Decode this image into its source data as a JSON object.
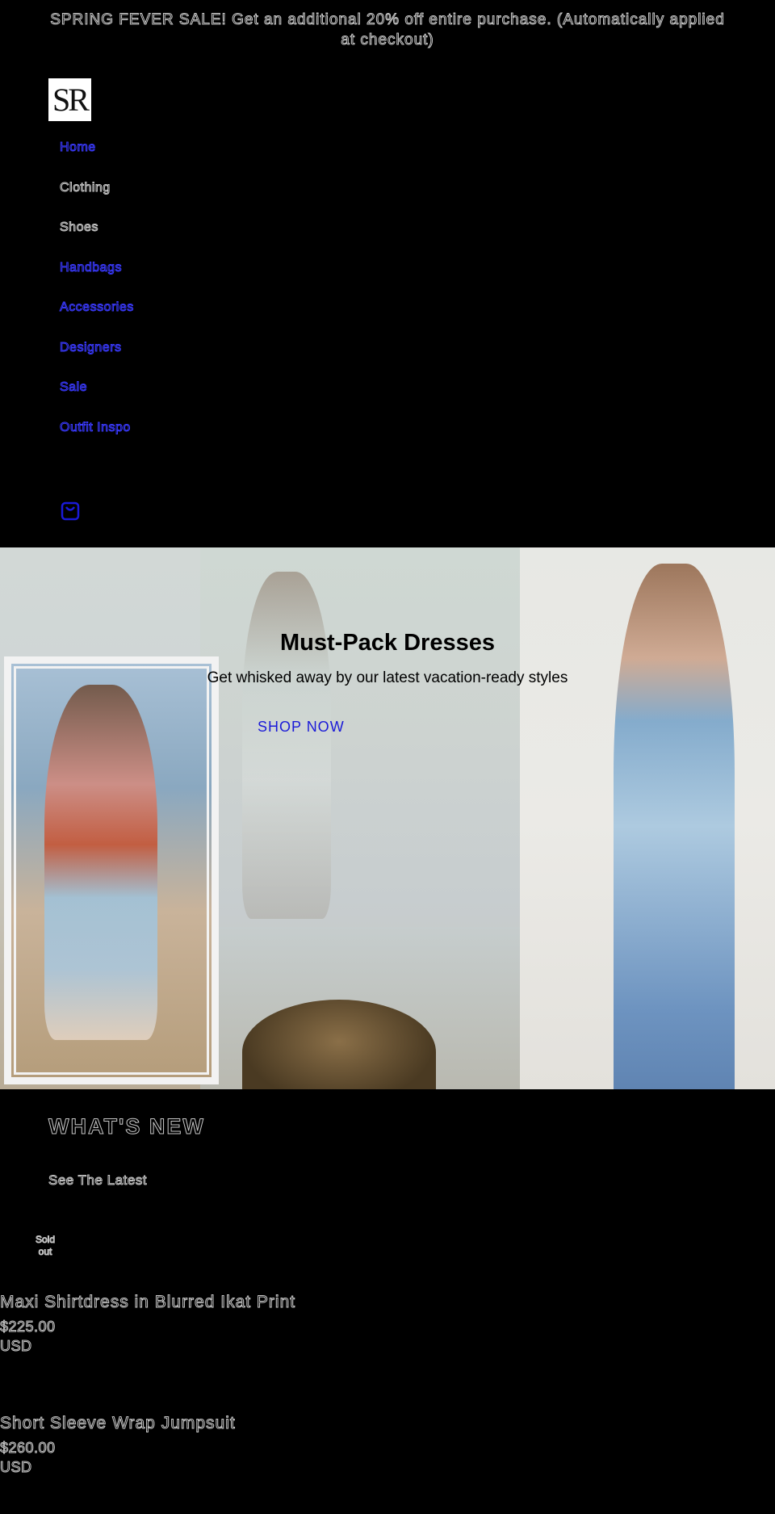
{
  "announcement": {
    "text": "SPRING FEVER SALE! Get an additional 20% off entire purchase. (Automatically applied at checkout)"
  },
  "logo": {
    "text": "SR"
  },
  "nav": {
    "items": [
      {
        "label": "Home",
        "link": true
      },
      {
        "label": "Clothing",
        "link": false
      },
      {
        "label": "Shoes",
        "link": false
      },
      {
        "label": "Handbags",
        "link": true
      },
      {
        "label": "Accessories",
        "link": true
      },
      {
        "label": "Designers",
        "link": true
      },
      {
        "label": "Sale",
        "link": true
      },
      {
        "label": "Outfit Inspo",
        "link": true
      }
    ]
  },
  "header": {
    "cart_icon": "shopping-bag-icon"
  },
  "hero": {
    "title": "Must-Pack Dresses",
    "subtitle": "Get whisked away by our latest vacation-ready styles",
    "cta_label": "SHOP NOW"
  },
  "whats_new": {
    "title": "WHAT'S NEW",
    "subtitle": "See The Latest"
  },
  "badge": {
    "line1": "Sold",
    "line2": "out"
  },
  "products": [
    {
      "name": "Maxi Shirtdress in Blurred Ikat Print",
      "price": "$225.00",
      "currency": "USD"
    },
    {
      "name": "Short Sleeve Wrap Jumpsuit",
      "price": "$260.00",
      "currency": "USD"
    }
  ],
  "colors": {
    "background": "#000000",
    "link": "#3a3aff",
    "cta": "#1a1ad8",
    "outline_text": "#c8c8c8"
  }
}
